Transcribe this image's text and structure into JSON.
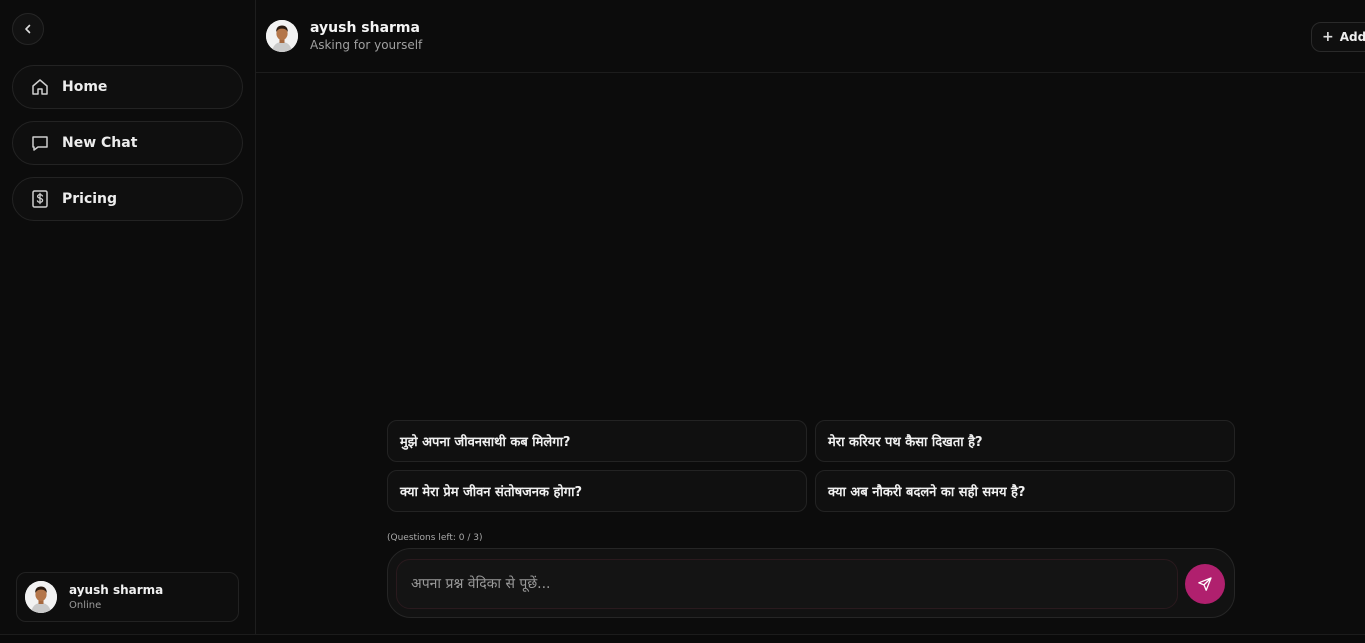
{
  "sidebar": {
    "items": [
      {
        "label": "Home",
        "icon": "home-icon"
      },
      {
        "label": "New Chat",
        "icon": "chat-bubble-icon"
      },
      {
        "label": "Pricing",
        "icon": "dollar-sign-icon"
      }
    ],
    "profile": {
      "name": "ayush sharma",
      "status": "Online"
    }
  },
  "header": {
    "name": "ayush sharma",
    "subtitle": "Asking for yourself",
    "add_label": "Add"
  },
  "suggestions": [
    "मुझे अपना जीवनसाथी कब मिलेगा?",
    "मेरा करियर पथ कैसा दिखता है?",
    "क्या मेरा प्रेम जीवन संतोषजनक होगा?",
    "क्या अब नौकरी बदलने का सही समय है?"
  ],
  "composer": {
    "questions_left": "(Questions left: 0 / 3)",
    "placeholder": "अपना प्रश्न वेदिका से पूछें..."
  },
  "colors": {
    "accent": "#b0206e",
    "background": "#0c0c0c"
  }
}
